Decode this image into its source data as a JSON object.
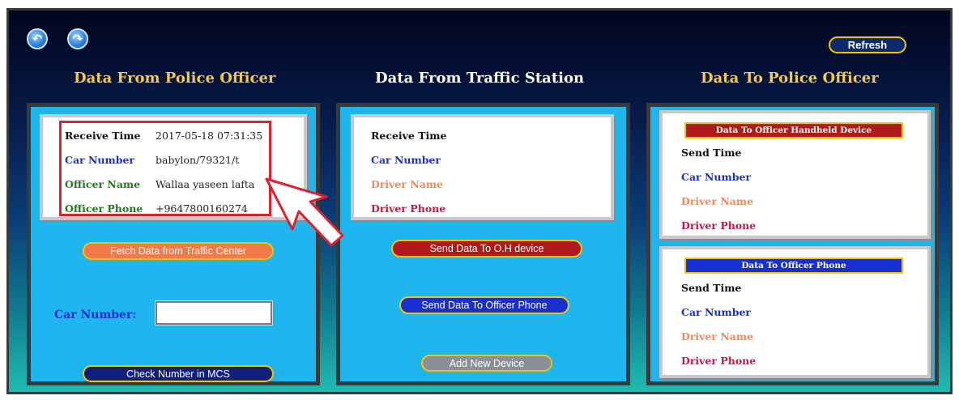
{
  "toolbar": {
    "back_icon": "back-arrow-icon",
    "forward_icon": "redo-arrow-icon",
    "back_glyph": "↶",
    "forward_glyph": "↷",
    "refresh_label": "Refresh"
  },
  "sections": {
    "left_title": "Data From Police Officer",
    "middle_title": "Data From Traffic Station",
    "right_title": "Data To Police Officer"
  },
  "left": {
    "fields": [
      {
        "label": "Receive Time",
        "value": "2017-05-18 07:31:35"
      },
      {
        "label": "Car Number",
        "value": "babylon/79321/t"
      },
      {
        "label": "Officer Name",
        "value": "Wallaa yaseen lafta"
      },
      {
        "label": "Officer Phone",
        "value": "+9647800160274"
      }
    ],
    "fetch_button": "Fetch Data from Traffic Center",
    "car_number_label": "Car Number:",
    "car_number_value": "",
    "check_button": "Check Number in MCS"
  },
  "middle": {
    "fields": [
      "Receive Time",
      "Car Number",
      "Driver Name",
      "Driver Phone"
    ],
    "send_oh_button": "Send Data To O.H device",
    "send_phone_button": "Send Data To Officer Phone",
    "add_device_button": "Add New Device"
  },
  "right": {
    "handheld_banner": "Data To Officer Handheld Device",
    "handheld_fields": [
      "Send Time",
      "Car Number",
      "Driver Name",
      "Driver Phone"
    ],
    "phone_banner": "Data To Officer Phone",
    "phone_fields": [
      "Send Time",
      "Car Number",
      "Driver Name",
      "Driver Phone"
    ]
  },
  "colors": {
    "panel_bg": "#1fb5ee",
    "title_gold": "#f7c948",
    "highlight_red": "#e0202a",
    "label_blue": "#1a2fd0",
    "label_green": "#1f7a1f",
    "label_salmon": "#f08a5d",
    "label_crimson": "#c21843"
  }
}
